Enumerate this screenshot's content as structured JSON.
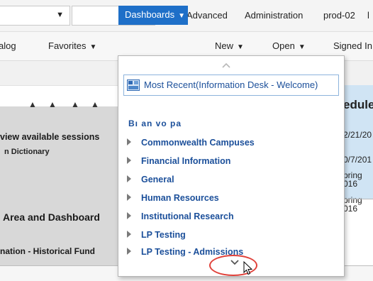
{
  "topbar": {
    "search_select_caret": "▼",
    "advanced": "Advanced",
    "administration": "Administration",
    "server": "prod-02"
  },
  "menubar": {
    "catalog": "alog",
    "favorites": "Favorites",
    "dashboards": "Dashboards",
    "new": "New",
    "open": "Open",
    "signed_in": "Signed In",
    "dropdown_glyph": "▼"
  },
  "background": {
    "view_sessions": "view available sessions",
    "dictionary": "n Dictionary",
    "area_dashboard": "Area and Dashboard",
    "historical_fund": "nation - Historical Fund",
    "right_title": "edule",
    "right_rows": [
      "2/21/20",
      "",
      "0/7/201",
      "pring",
      "016",
      "pring",
      "016"
    ]
  },
  "dropdown": {
    "recent_label": "Most Recent(Information Desk - Welcome)",
    "garbled_text": "Bı  an  vo  pa",
    "items": [
      "Commonwealth Campuses",
      "Financial Information",
      "General",
      "Human Resources",
      "Institutional Research",
      "LP Testing",
      "LP Testing - Admissions"
    ]
  }
}
